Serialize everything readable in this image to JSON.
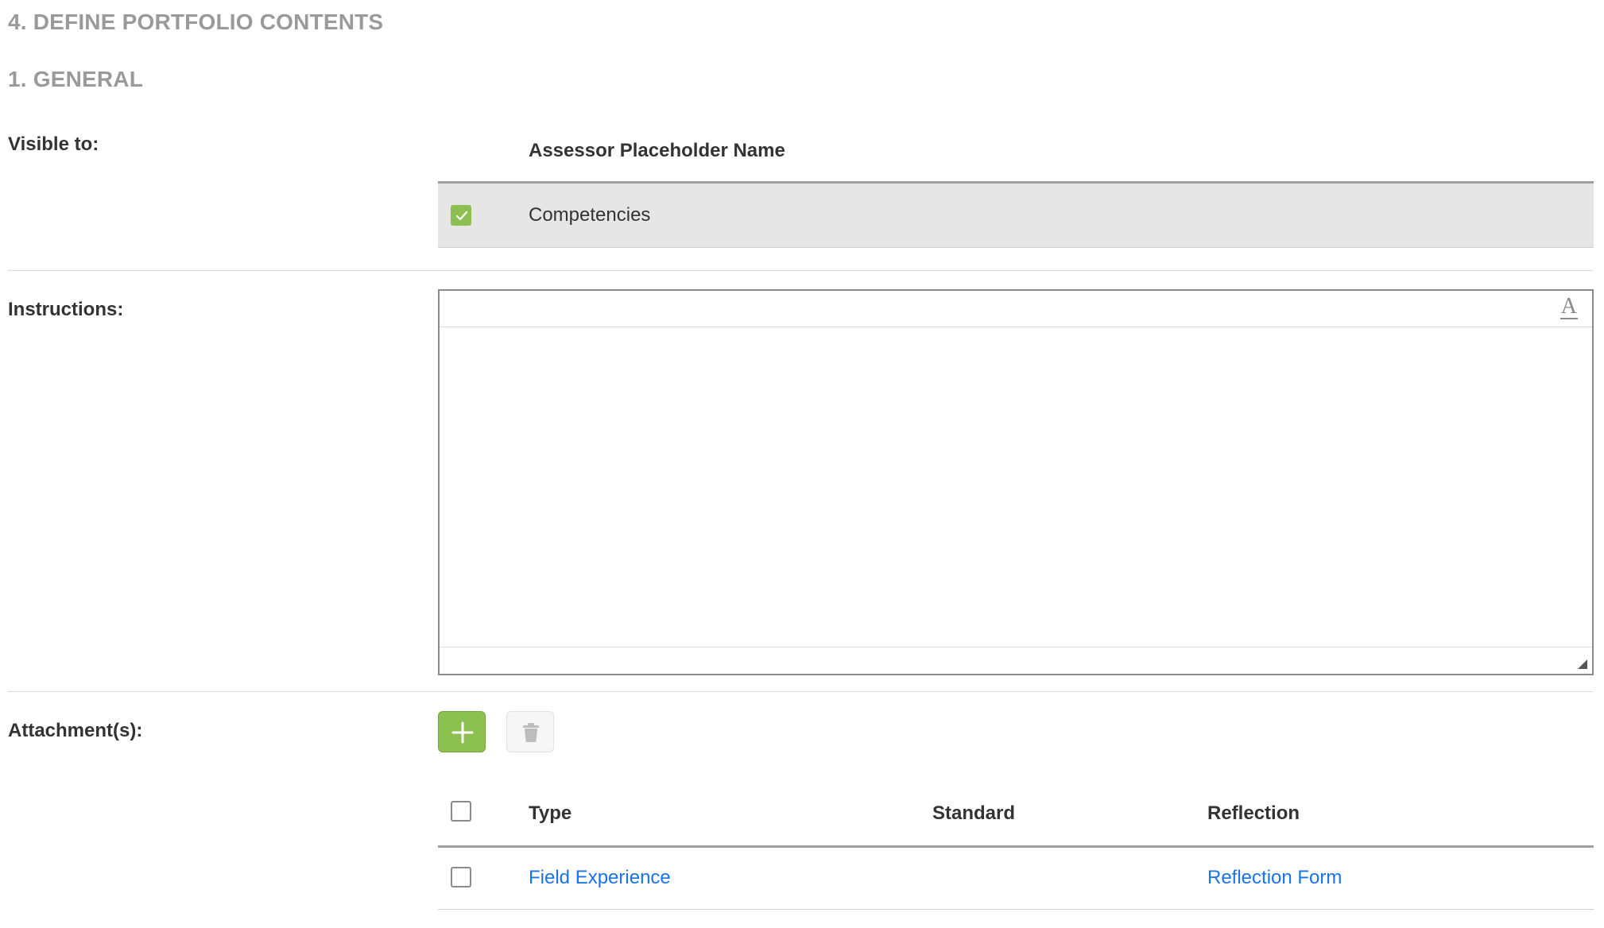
{
  "headings": {
    "portfolio": "4. DEFINE PORTFOLIO CONTENTS",
    "general": "1. GENERAL"
  },
  "visible_to": {
    "label": "Visible to:",
    "column_header": "Assessor Placeholder Name",
    "rows": [
      {
        "label": "Competencies",
        "checked": true
      }
    ]
  },
  "instructions": {
    "label": "Instructions:",
    "value": "",
    "format_icon": "A"
  },
  "attachments": {
    "label": "Attachment(s):",
    "add_icon": "plus-icon",
    "delete_icon": "trash-icon",
    "columns": [
      "Type",
      "Standard",
      "Reflection"
    ],
    "rows": [
      {
        "type": "Field Experience",
        "standard": "",
        "reflection": "Reflection Form",
        "checked": false
      }
    ]
  },
  "colors": {
    "accent_green": "#8cc152",
    "link_blue": "#1a73e8",
    "heading_gray": "#9a9a9a"
  }
}
